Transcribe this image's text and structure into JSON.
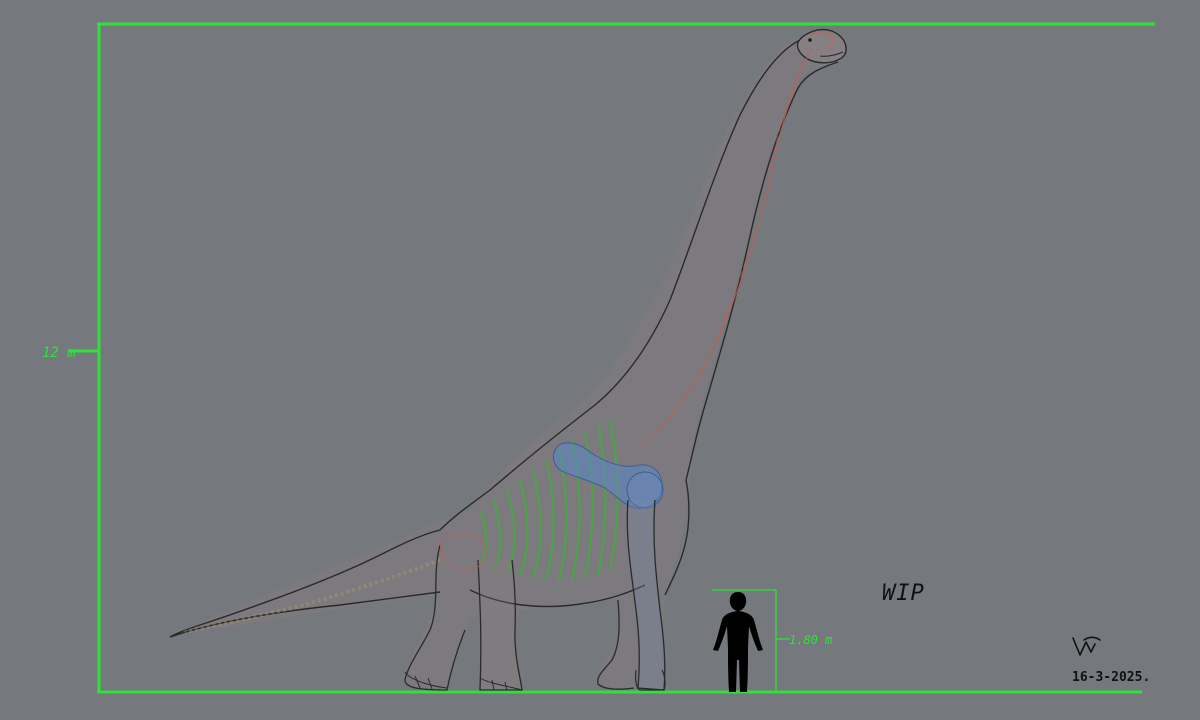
{
  "scale": {
    "total_height_label": "12 m",
    "human_height_label": "1.80 m",
    "color": "#2ee23a"
  },
  "annotations": {
    "status": "WIP",
    "date": "16-3-2025."
  },
  "colors": {
    "background": "#75787c",
    "sketch_line": "#2a2a2a",
    "ribs": "#3fae3a",
    "shoulder_bone": "#5a86c8",
    "red_guides": "#c85a50",
    "human": "#000000"
  },
  "icons": {
    "signature": "artist-signature-icon"
  }
}
